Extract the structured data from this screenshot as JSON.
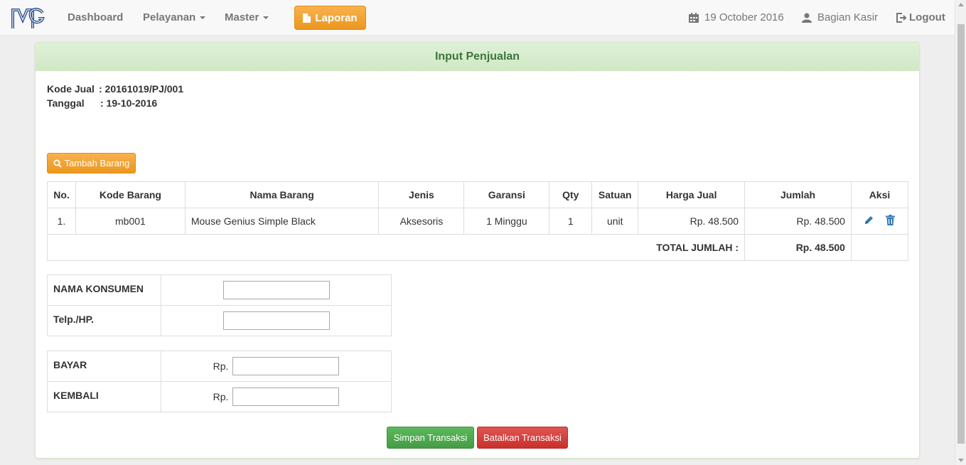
{
  "nav": {
    "dashboard": "Dashboard",
    "pelayanan": "Pelayanan",
    "master": "Master",
    "laporan": "Laporan",
    "date": "19 October 2016",
    "user": "Bagian Kasir",
    "logout": "Logout"
  },
  "panel": {
    "title": "Input Penjualan",
    "kode_jual_label": "Kode Jual",
    "kode_jual_value": ": 20161019/PJ/001",
    "tanggal_label": "Tanggal",
    "tanggal_value": ": 19-10-2016",
    "tambah_label": "Tambah Barang"
  },
  "table": {
    "headers": [
      "No.",
      "Kode Barang",
      "Nama Barang",
      "Jenis",
      "Garansi",
      "Qty",
      "Satuan",
      "Harga Jual",
      "Jumlah",
      "Aksi"
    ],
    "rows": [
      {
        "no": "1.",
        "kode": "mb001",
        "nama": "Mouse Genius Simple Black",
        "jenis": "Aksesoris",
        "garansi": "1 Minggu",
        "qty": "1",
        "satuan": "unit",
        "harga": "Rp. 48.500",
        "jumlah": "Rp. 48.500"
      }
    ],
    "total_label": "TOTAL JUMLAH :",
    "total_value": "Rp. 48.500"
  },
  "customer": {
    "nama_label": "NAMA KONSUMEN",
    "nama_value": "",
    "telp_label": "Telp./HP.",
    "telp_value": ""
  },
  "payment": {
    "bayar_label": "BAYAR",
    "bayar_prefix": "Rp.",
    "bayar_value": "",
    "kembali_label": "KEMBALI",
    "kembali_prefix": "Rp.",
    "kembali_value": ""
  },
  "actions": {
    "simpan": "Simpan Transaksi",
    "batal": "Batalkan Transaksi"
  },
  "colors": {
    "warning": "#f0ad4e",
    "success": "#5cb85c",
    "danger": "#d9534f",
    "panel_heading": "#dff0d8",
    "panel_title": "#3c763d",
    "icon_blue": "#337ab7"
  }
}
